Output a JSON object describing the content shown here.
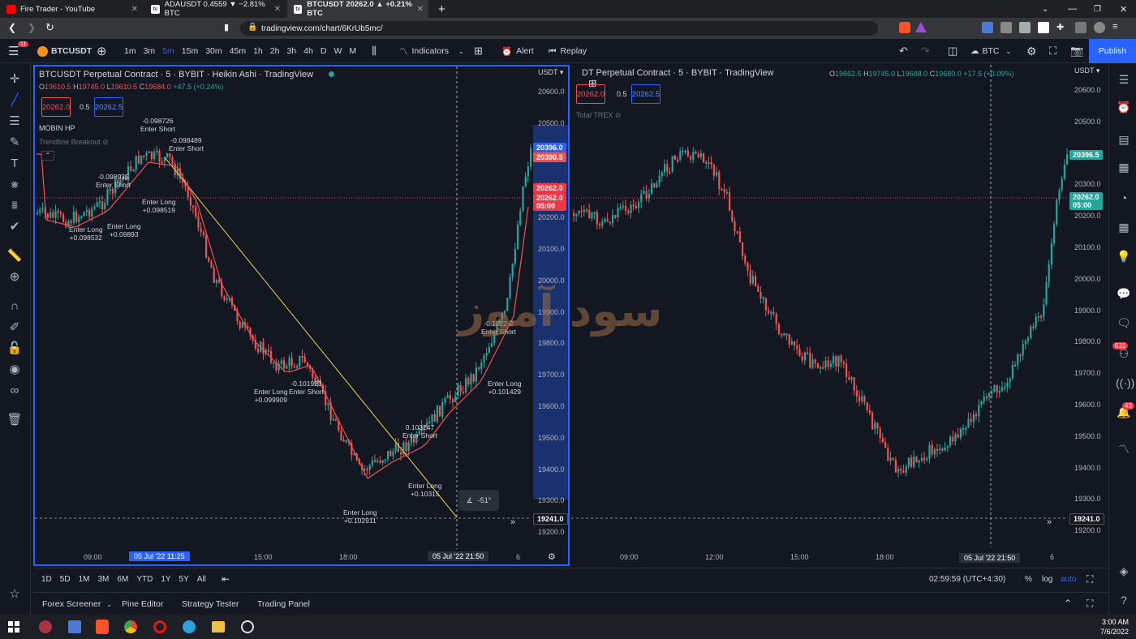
{
  "browser": {
    "tabs": [
      {
        "label": "Fire Trader - YouTube",
        "color": "#ff0000"
      },
      {
        "label": "ADAUSDT 0.4559 ▼ −2.81% BTC",
        "color": "#ffffff"
      },
      {
        "label": "BTCUSDT 20262.0 ▲ +0.21% BTC",
        "color": "#ffffff"
      }
    ],
    "url": "tradingview.com/chart/6KrUb5mc/",
    "new_tab": "+"
  },
  "toolbar": {
    "notif": "11",
    "symbol": "BTCUSDT",
    "intervals": [
      "1m",
      "3m",
      "5m",
      "15m",
      "30m",
      "45m",
      "1h",
      "2h",
      "3h",
      "4h",
      "D",
      "W",
      "M"
    ],
    "active_interval": "5m",
    "indicators": "Indicators",
    "alert": "Alert",
    "replay": "Replay",
    "currency": "BTC",
    "publish": "Publish"
  },
  "pane1": {
    "title": "BTCUSDT Perpetual Contract · 5 · BYBIT · Heikin Ashi · TradingView",
    "ohlc": {
      "o": "19610.5",
      "h": "19745.0",
      "l": "19610.5",
      "c": "19684.0",
      "chg": "+47.5 (+0.24%)"
    },
    "sell": "20262.0",
    "spread": "0.5",
    "buy": "20262.5",
    "ind1": "MOBIN HP",
    "ind2": "Trendline Breakout",
    "currency": "USDT",
    "price_ticks": [
      "20600.0",
      "20500.0",
      "20400.0",
      "20300.0",
      "20200.0",
      "20100.0",
      "20000.0",
      "19900.0",
      "19800.0",
      "19700.0",
      "19600.0",
      "19500.0",
      "19400.0",
      "19300.0",
      "19200.0"
    ],
    "tags": {
      "blue": "20396.0",
      "red1": "20390.5",
      "cur": "20262.0",
      "cur2": "20262.0",
      "cd": "05:00",
      "red3": "20262.0",
      "line": "19241.0"
    },
    "time_ticks": [
      "09:00",
      "15:00",
      "18:00",
      "6"
    ],
    "time_hl1": "05 Jul '22   11:25",
    "time_hl2": "05 Jul '22   21:50",
    "angle": "-51°",
    "annotations": [
      {
        "t": "-0.098726",
        "s": "Enter Short"
      },
      {
        "t": "-0.098489",
        "s": "Enter Short"
      },
      {
        "t": "-0.098935",
        "s": "Enter Short"
      },
      {
        "t": "Enter Long",
        "s": "+0.098519"
      },
      {
        "t": "Enter Long",
        "s": "+0.098532"
      },
      {
        "t": "Enter Long",
        "s": "+0.09893"
      },
      {
        "t": "-0.101923",
        "s": "Enter Short"
      },
      {
        "t": "Enter Long",
        "s": "+0.099909"
      },
      {
        "t": "0.103247",
        "s": "Enter Short"
      },
      {
        "t": "Enter Long",
        "s": "+0.10315"
      },
      {
        "t": "Enter Long",
        "s": "+0.102911"
      },
      {
        "t": "-0.1022-2",
        "s": "Enter Short"
      },
      {
        "t": "Enter Long",
        "s": "+0.101429"
      }
    ]
  },
  "pane2": {
    "title": "DT Perpetual Contract · 5 · BYBIT · TradingView",
    "ohlc": {
      "o": "19662.5",
      "h": "19745.0",
      "l": "19648.0",
      "c": "19680.0",
      "chg": "+17.5 (+0.09%)"
    },
    "sell": "20262.0",
    "spread": "0.5",
    "buy": "20262.5",
    "ind": "Total TREX",
    "currency": "USDT",
    "tags": {
      "green": "20396.5",
      "cur": "20262.0",
      "cd": "05:00",
      "line": "19241.0"
    },
    "time_ticks": [
      "09:00",
      "12:00",
      "15:00",
      "18:00",
      "6"
    ],
    "time_hl": "05 Jul '22   21:50",
    "watermark": "سود آموز"
  },
  "bottom": {
    "ranges": [
      "1D",
      "5D",
      "1M",
      "3M",
      "6M",
      "YTD",
      "1Y",
      "5Y",
      "All"
    ],
    "clock": "02:59:59 (UTC+4:30)",
    "pct": "%",
    "log": "log",
    "auto": "auto"
  },
  "panels": [
    "Forex Screener",
    "Pine Editor",
    "Strategy Tester",
    "Trading Panel"
  ],
  "right_badges": {
    "a": "631",
    "b": "43"
  },
  "taskbar": {
    "time": "3:00 AM",
    "date": "7/6/2022"
  },
  "colors": {
    "up": "#26a69a",
    "down": "#ef5350",
    "accent": "#2962ff",
    "bg": "#131722"
  }
}
